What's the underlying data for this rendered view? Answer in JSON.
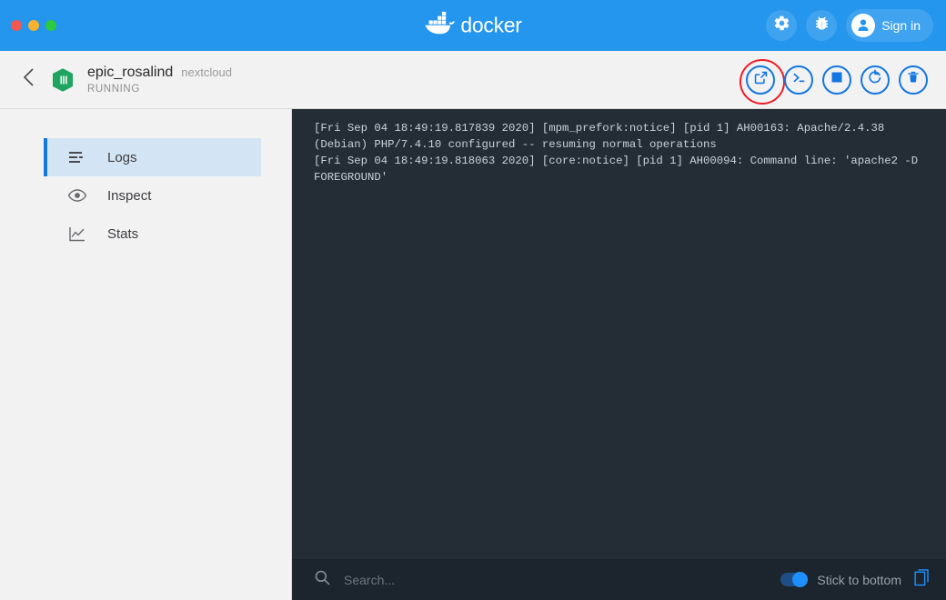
{
  "window": {
    "traffic_lights": [
      {
        "name": "close",
        "color": "#f3584f"
      },
      {
        "name": "minimize",
        "color": "#f7b32f"
      },
      {
        "name": "zoom",
        "color": "#2dc93f"
      }
    ]
  },
  "titlebar": {
    "brand": "docker",
    "brand_icon": "docker-whale-logo",
    "background": "#2496ed",
    "settings_icon": "gear-icon",
    "bug_icon": "bug-icon",
    "signin_label": "Sign in",
    "signin_icon": "user-avatar-icon"
  },
  "container_header": {
    "back_icon": "chevron-left-icon",
    "container_icon": "container-cube-icon",
    "name": "epic_rosalind",
    "image": "nextcloud",
    "status": "RUNNING",
    "accent": "#1277e2",
    "highlight_color": "#ee1d23",
    "actions": [
      {
        "name": "open-in-browser",
        "icon": "external-link-icon",
        "label": "Open in browser",
        "highlighted": true
      },
      {
        "name": "cli",
        "icon": "terminal-prompt-icon",
        "label": "CLI",
        "highlighted": false
      },
      {
        "name": "stop",
        "icon": "stop-square-icon",
        "label": "Stop",
        "highlighted": false
      },
      {
        "name": "restart",
        "icon": "restart-circular-arrow-icon",
        "label": "Restart",
        "highlighted": false
      },
      {
        "name": "delete",
        "icon": "trash-icon",
        "label": "Delete",
        "highlighted": false
      }
    ]
  },
  "sidebar": {
    "items": [
      {
        "label": "Logs",
        "icon": "logs-lines-icon",
        "active": true
      },
      {
        "label": "Inspect",
        "icon": "eye-icon",
        "active": false
      },
      {
        "label": "Stats",
        "icon": "chart-line-icon",
        "active": false
      }
    ]
  },
  "logs": {
    "background": "#242c35",
    "lines": [
      "[Fri Sep 04 18:49:19.817839 2020] [mpm_prefork:notice] [pid 1] AH00163: Apache/2.4.38 (Debian) PHP/7.4.10 configured -- resuming normal operations",
      "[Fri Sep 04 18:49:19.818063 2020] [core:notice] [pid 1] AH00094: Command line: 'apache2 -D FOREGROUND'"
    ]
  },
  "searchbar": {
    "search_icon": "search-icon",
    "placeholder": "Search...",
    "value": "",
    "stick_label": "Stick to bottom",
    "stick_enabled": true,
    "copy_icon": "copy-icon"
  }
}
